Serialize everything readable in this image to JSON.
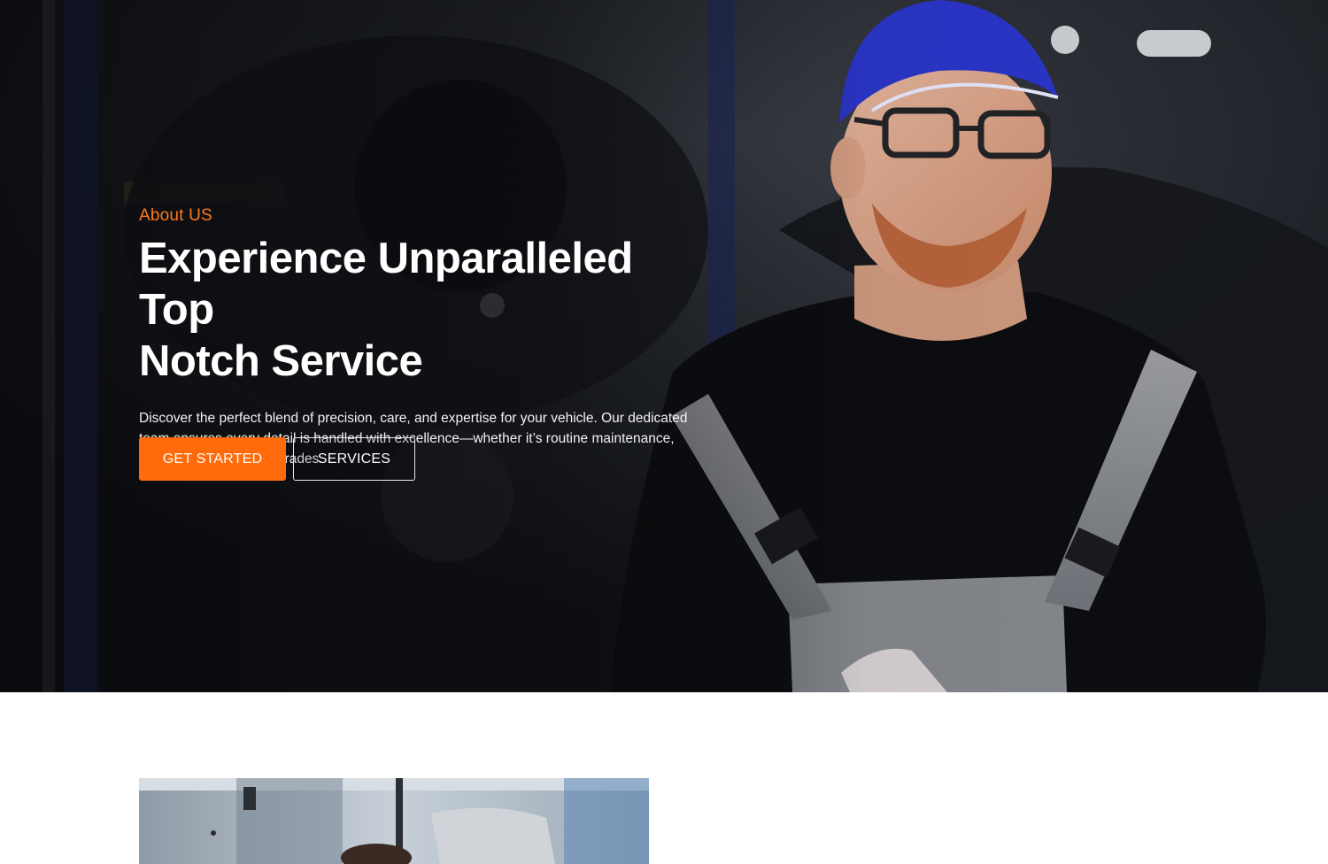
{
  "hero": {
    "eyebrow": "About US",
    "title_line1": "Experience Unparalleled Top",
    "title_line2": "Notch Service",
    "description": "Discover the perfect blend of precision, care, and expertise for your vehicle. Our dedicated team ensures every detail is handled with excellence—whether it’s routine maintenance, repairs, or premium upgrades.",
    "buttons": {
      "primary": "GET STARTED",
      "secondary": "SERVICES"
    }
  },
  "colors": {
    "accent": "#ff6b0a",
    "eyebrow": "#ff7a1a",
    "cap": "#2a35c9"
  }
}
